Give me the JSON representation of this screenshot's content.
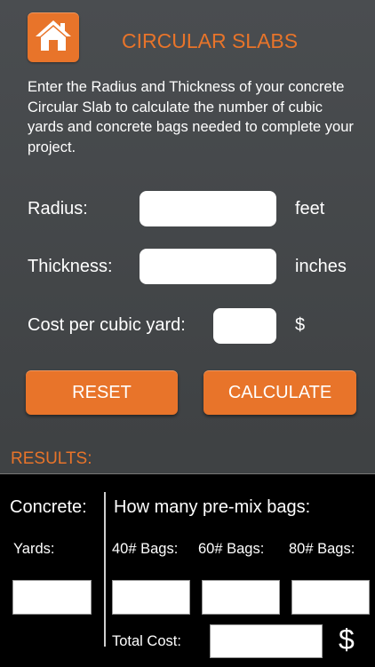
{
  "header": {
    "title": "CIRCULAR SLABS",
    "home_icon": "home-icon"
  },
  "intro": "Enter the Radius and Thickness of your concrete Circular Slab to calculate the number of cubic yards and concrete bags needed to complete your project.",
  "form": {
    "radius": {
      "label": "Radius:",
      "value": "",
      "unit": "feet"
    },
    "thickness": {
      "label": "Thickness:",
      "value": "",
      "unit": "inches"
    },
    "cost": {
      "label": "Cost per cubic yard:",
      "value": "",
      "unit": "$"
    }
  },
  "buttons": {
    "reset": "RESET",
    "calculate": "CALCULATE"
  },
  "results": {
    "title": "RESULTS:",
    "concrete_label": "Concrete:",
    "bags_heading": "How many pre-mix bags:",
    "yards_label": "Yards:",
    "bag40_label": "40# Bags:",
    "bag60_label": "60# Bags:",
    "bag80_label": "80# Bags:",
    "total_cost_label": "Total Cost:",
    "currency_symbol": "$",
    "yards_value": "",
    "bag40_value": "",
    "bag60_value": "",
    "bag80_value": "",
    "total_cost_value": ""
  },
  "colors": {
    "accent": "#e8742a",
    "background": "#3f4244",
    "results_background": "#000000"
  }
}
